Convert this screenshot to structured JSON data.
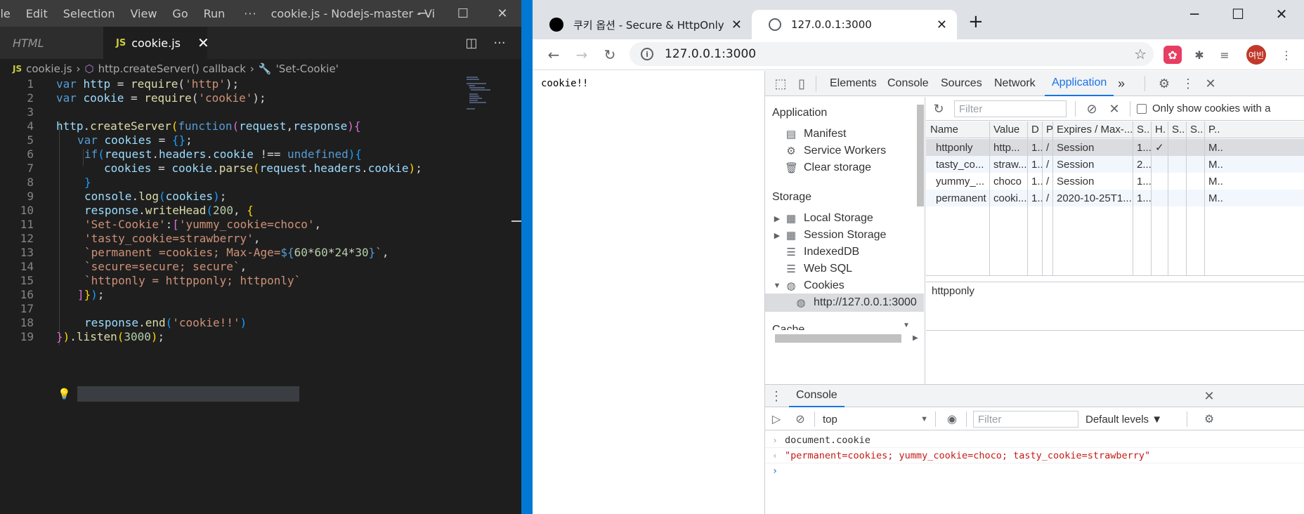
{
  "vscode": {
    "menu": [
      "ile",
      "Edit",
      "Selection",
      "View",
      "Go",
      "Run"
    ],
    "more": "···",
    "window_title": "cookie.js - Nodejs-master - Visu...",
    "win_buttons": {
      "minimize": "─",
      "maximize": "☐",
      "close": "✕"
    },
    "tabs": [
      {
        "label": "HTML"
      },
      {
        "icon": "JS",
        "label": "cookie.js",
        "close": "✕"
      }
    ],
    "toolbar": {
      "split": "◫",
      "more": "···"
    },
    "breadcrumb": [
      "cookie.js",
      "http.createServer() callback",
      "'Set-Cookie'"
    ],
    "line_numbers": [
      "1",
      "2",
      "3",
      "4",
      "5",
      "6",
      "7",
      "8",
      "9",
      "10",
      "11",
      "12",
      "13",
      "14",
      "15",
      "16",
      "17",
      "18",
      "19"
    ],
    "code": [
      "var http = require('http');",
      "var cookie = require('cookie');",
      "",
      "http.createServer(function(request,response){",
      "var cookies = {};",
      "if(request.headers.cookie !== undefined){",
      "cookies = cookie.parse(request.headers.cookie);",
      "}",
      "console.log(cookies);",
      "response.writeHead(200, {",
      "'Set-Cookie':['yummy_cookie=choco',",
      "'tasty_cookie=strawberry',",
      "`permanent =cookies; Max-Age=${60*60*24*30}`,",
      "`secure=secure; secure`,",
      "`httponly = httpponly; httponly`",
      "]});",
      "",
      "response.end('cookie!!')",
      "}).listen(3000);"
    ]
  },
  "chrome": {
    "tabs": [
      {
        "title": "쿠키 옵션 - Secure & HttpOnly",
        "close": "✕"
      },
      {
        "title": "127.0.0.1:3000",
        "close": "✕"
      }
    ],
    "new_tab": "+",
    "win_buttons": {
      "minimize": "─",
      "maximize": "☐",
      "close": "✕"
    },
    "nav": {
      "back": "←",
      "forward": "→",
      "reload": "↻"
    },
    "address": "127.0.0.1:3000",
    "address_info": "i",
    "bookmark_star": "☆",
    "extensions": [
      "✿",
      "✱",
      "≡"
    ],
    "avatar_text": "여빈",
    "menu": "⋮",
    "page_text": "cookie!!"
  },
  "devtools": {
    "tabs": [
      "Elements",
      "Console",
      "Sources",
      "Network",
      "Application"
    ],
    "active_tab": "Application",
    "more_tabs": "»",
    "icons": {
      "inspect": "⬚",
      "device": "▯",
      "settings": "⚙",
      "menu": "⋮",
      "close": "✕"
    },
    "sidebar": {
      "application_head": "Application",
      "application_items": [
        {
          "icon": "▤",
          "label": "Manifest"
        },
        {
          "icon": "⚙",
          "label": "Service Workers"
        },
        {
          "icon": "🗑",
          "label": "Clear storage"
        }
      ],
      "storage_head": "Storage",
      "storage_items": [
        {
          "tri": "▶",
          "icon": "▦",
          "label": "Local Storage"
        },
        {
          "tri": "▶",
          "icon": "▦",
          "label": "Session Storage"
        },
        {
          "tri": "",
          "icon": "☰",
          "label": "IndexedDB"
        },
        {
          "tri": "",
          "icon": "☰",
          "label": "Web SQL"
        },
        {
          "tri": "▼",
          "icon": "◍",
          "label": "Cookies"
        }
      ],
      "cookie_origin": "http://127.0.0.1:3000",
      "cache_head": "Cache",
      "scroll_down": "▼",
      "scroll_right": "▶"
    },
    "cookies_toolbar": {
      "refresh": "↻",
      "filter_placeholder": "Filter",
      "clear_all": "⊘",
      "delete": "✕",
      "only_issues_label": "Only show cookies with a"
    },
    "cookie_columns": [
      "Name",
      "Value",
      "D",
      "P.",
      "Expires / Max-...",
      "S..",
      "H.",
      "S..",
      "S..",
      "P.."
    ],
    "cookie_rows": [
      [
        "httponly",
        "http...",
        "1..",
        "/",
        "Session",
        "1...",
        "✓",
        "",
        "",
        "M.."
      ],
      [
        "tasty_co...",
        "straw...",
        "1..",
        "/",
        "Session",
        "2...",
        "",
        "",
        "",
        "M.."
      ],
      [
        "yummy_...",
        "choco",
        "1..",
        "/",
        "Session",
        "1...",
        "",
        "",
        "",
        "M.."
      ],
      [
        "permanent",
        "cooki...",
        "1..",
        "/",
        "2020-10-25T1...",
        "1...",
        "",
        "",
        "",
        "M.."
      ]
    ],
    "preview_value": "httpponly",
    "drawer": {
      "menu": "⋮",
      "tab": "Console",
      "close": "✕",
      "context": "top",
      "context_caret": "▼",
      "filter_placeholder": "Filter",
      "levels": "Default levels ▼",
      "icons": {
        "sidebar": "▷",
        "clear": "⊘",
        "eye": "◉",
        "settings": "⚙"
      }
    },
    "console_lines": [
      {
        "prefix": "›",
        "text": "document.cookie",
        "color": "#333333"
      },
      {
        "prefix": "‹",
        "text": "\"permanent=cookies; yummy_cookie=choco; tasty_cookie=strawberry\"",
        "color": "#c41a16"
      },
      {
        "prefix": "›",
        "text": "",
        "color": "#1a73e8"
      }
    ]
  },
  "colors": {
    "vscode_accent": "#0078d4",
    "chrome_active": "#1a73e8"
  }
}
